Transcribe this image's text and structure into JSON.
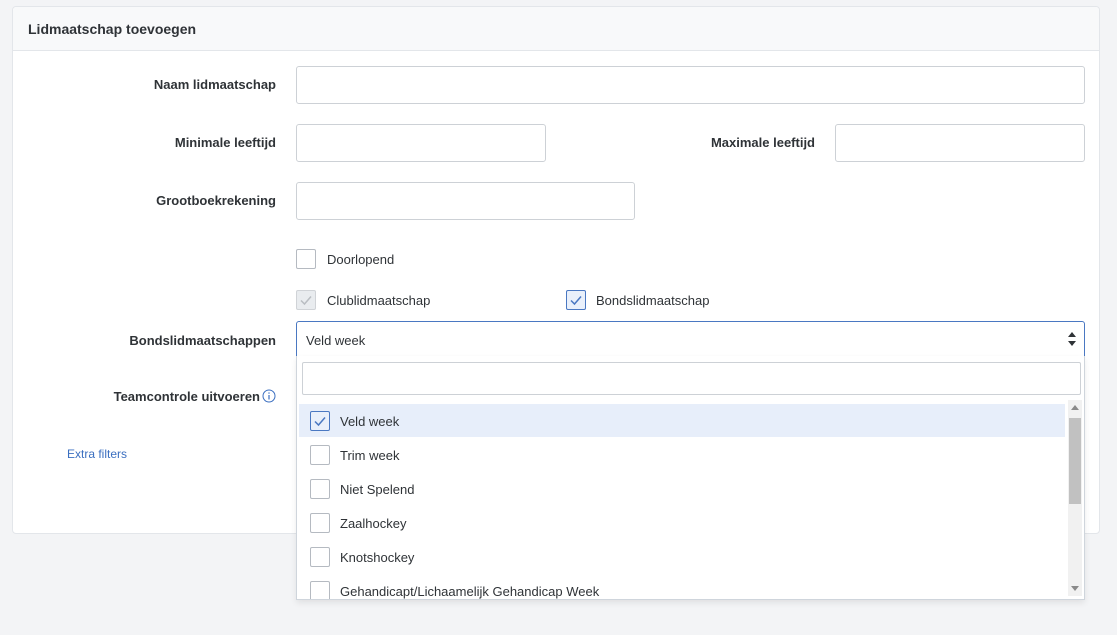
{
  "card": {
    "title": "Lidmaatschap toevoegen"
  },
  "form": {
    "name_label": "Naam lidmaatschap",
    "name_value": "",
    "min_age_label": "Minimale leeftijd",
    "min_age_value": "",
    "max_age_label": "Maximale leeftijd",
    "max_age_value": "",
    "ledger_label": "Grootboekrekening",
    "ledger_value": "",
    "continuous_label": "Doorlopend",
    "continuous_checked": false,
    "club_label": "Clublidmaatschap",
    "club_checked": true,
    "club_disabled": true,
    "federation_label": "Bondslidmaatschap",
    "federation_checked": true,
    "federation_memberships_label": "Bondslidmaatschappen",
    "federation_memberships_selected": "Veld week",
    "team_check_label": "Teamcontrole uitvoeren",
    "extra_filters_link": "Extra filters"
  },
  "dropdown": {
    "search_value": "",
    "options": [
      {
        "label": "Veld week",
        "checked": true
      },
      {
        "label": "Trim week",
        "checked": false
      },
      {
        "label": "Niet Spelend",
        "checked": false
      },
      {
        "label": "Zaalhockey",
        "checked": false
      },
      {
        "label": "Knotshockey",
        "checked": false
      },
      {
        "label": "Gehandicapt/Lichaamelijk Gehandicap Week",
        "checked": false
      }
    ]
  },
  "colors": {
    "accent": "#4a78c2",
    "link": "#3b6fc0",
    "active_option_bg": "#e7eefa",
    "page_bg": "#f3f4f6"
  },
  "icons": {
    "select_arrows": "sort-arrows-icon",
    "info": "info-circle-icon",
    "check": "checkmark-icon"
  }
}
